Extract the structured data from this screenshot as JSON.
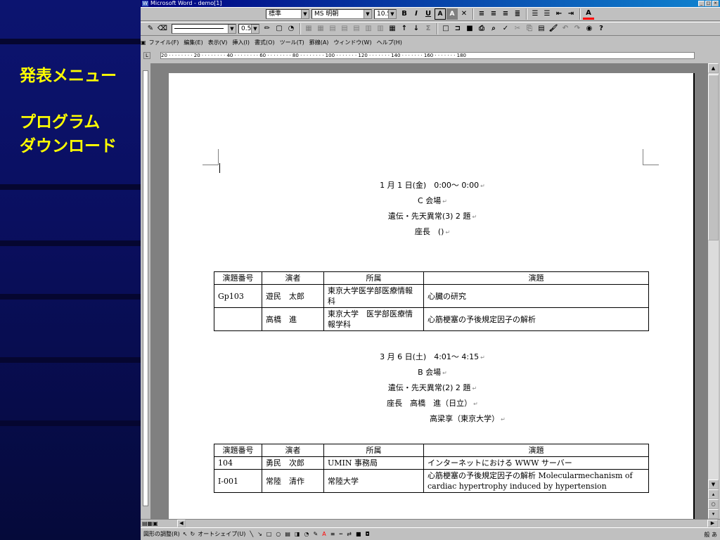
{
  "slide": {
    "menu_title": "発表メニュー",
    "link_line1": "プログラム",
    "link_line2": "ダウンロード"
  },
  "window": {
    "title": "Microsoft Word - demo[1]",
    "buttons": [
      "_",
      "□",
      "×"
    ]
  },
  "toolbar": {
    "style": "標準",
    "font": "MS 明朝",
    "size": "10.5",
    "line_width": "0.5"
  },
  "menu": [
    "ファイル(F)",
    "編集(E)",
    "表示(V)",
    "挿入(I)",
    "書式(O)",
    "ツール(T)",
    "罫線(A)",
    "ウィンドウ(W)",
    "ヘルプ(H)"
  ],
  "ruler": {
    "marks": "20 · · · · · · · · 20 · · · · · · · · 40 · · · · · · · · 60 · · · · · · · · 80 · · · · · · · · 100 · · · · · · · 120 · · · · · · · 140 · · · · · · · 160 · · · · · · · 180"
  },
  "document": {
    "session1": {
      "datetime": "1 月 1 日(金)　0:00～ 0:00",
      "venue": "C 会場",
      "topic": "遺伝・先天異常(3) 2 題",
      "chair": "座長　()"
    },
    "table1": {
      "headers": [
        "演題番号",
        "演者",
        "所属",
        "演題"
      ],
      "rows": [
        [
          "Gp103",
          "遊民　太郎",
          "東京大学医学部医療情報科",
          "心臓の研究"
        ],
        [
          "",
          "高橋　進",
          "東京大学　医学部医療情報学科",
          "心筋梗塞の予後規定因子の解析"
        ]
      ]
    },
    "session2": {
      "datetime": "3 月 6 日(土)　4:01～ 4:15",
      "venue": "B 会場",
      "topic": "遺伝・先天異常(2) 2 題",
      "chair": "座長　高橋　進（日立）",
      "chair2": "高梁享（東京大学）"
    },
    "table2": {
      "headers": [
        "演題番号",
        "演者",
        "所属",
        "演題"
      ],
      "rows": [
        [
          "104",
          "勇民　次郎",
          "UMIN 事務局",
          "インターネットにおける WWW サーバー"
        ],
        [
          "I-001",
          "常陸　清作",
          "常陸大学",
          "心筋梗塞の予後規定因子の解析 Molecularmechanism of cardiac hypertrophy induced by hypertension"
        ]
      ]
    }
  },
  "drawbar": {
    "draw": "図形の調整(R)",
    "autoshape": "オートシェイプ(U)"
  }
}
